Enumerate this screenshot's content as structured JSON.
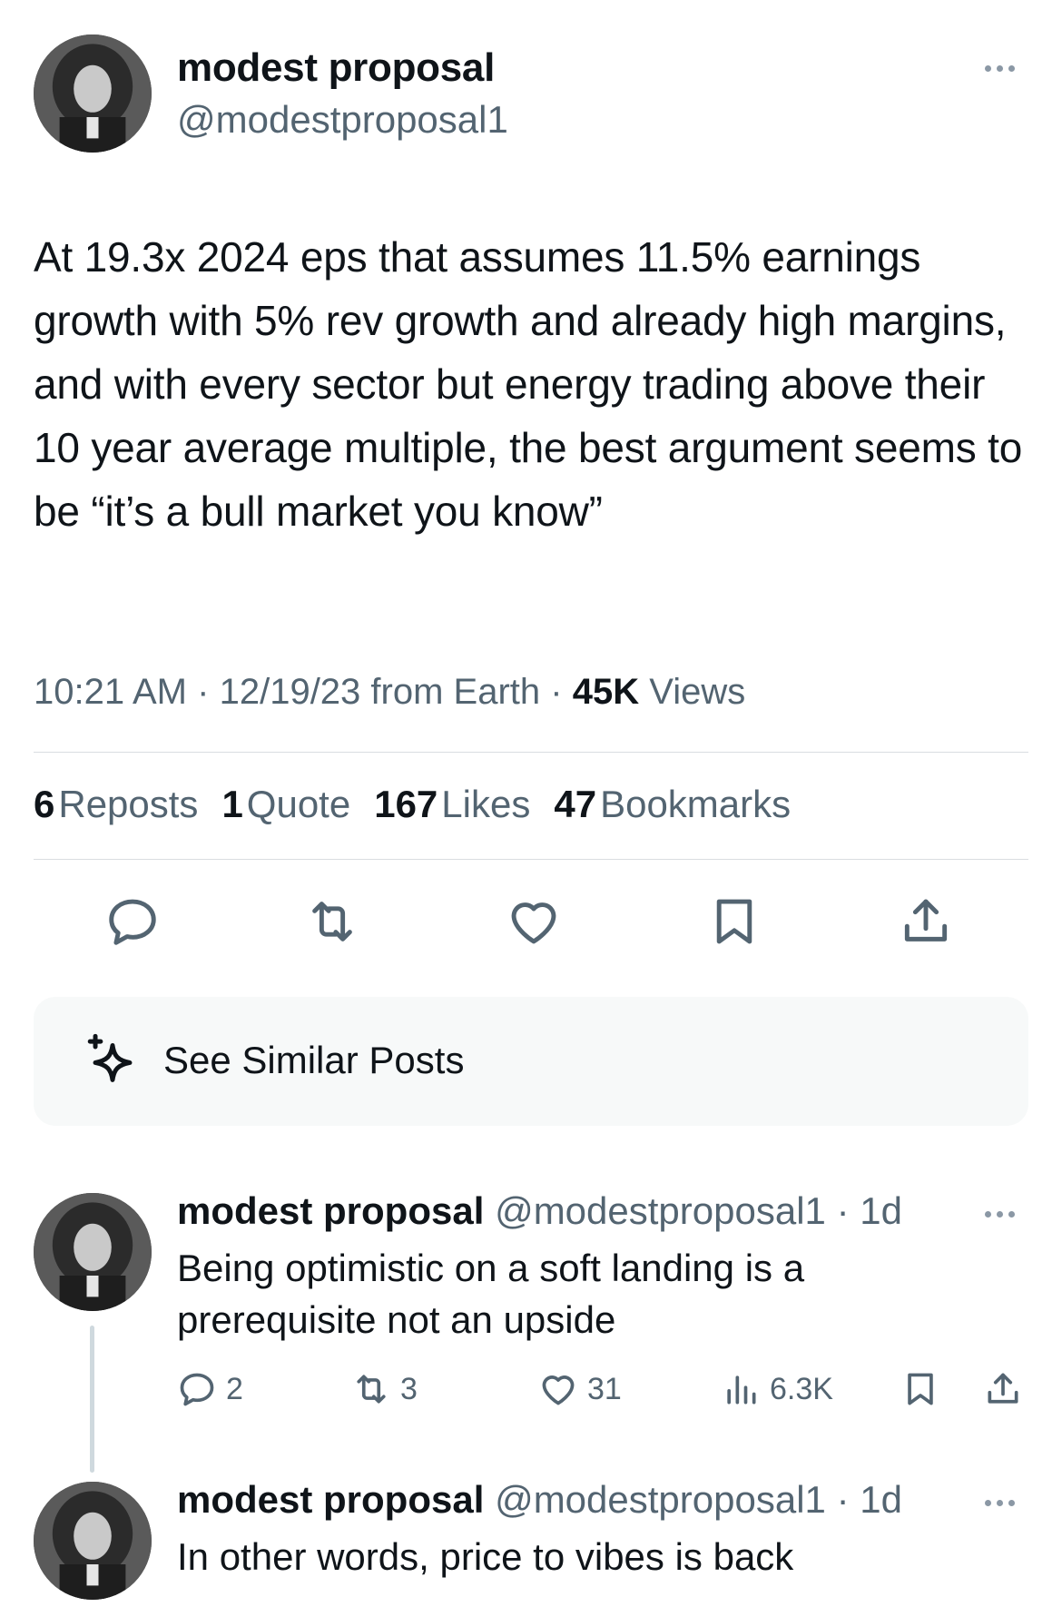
{
  "colors": {
    "text": "#0f1419",
    "muted": "#536471",
    "divider": "#d9dde1",
    "card_bg": "#f7f9f9"
  },
  "main_tweet": {
    "name": "modest proposal",
    "handle": "@modestproposal1",
    "text": "At 19.3x 2024 eps that assumes 11.5% earnings growth with 5% rev growth and already high margins, and with every sector but energy trading above their 10 year average multiple, the best argument seems to be “it’s a bull market you know”",
    "time": "10:21 AM",
    "sep1": "·",
    "date_location": "12/19/23 from Earth",
    "sep2": "·",
    "views_count": "45K",
    "views_label": "Views",
    "stats": {
      "reposts_n": "6",
      "reposts_l": "Reposts",
      "quote_n": "1",
      "quote_l": "Quote",
      "likes_n": "167",
      "likes_l": "Likes",
      "bookmarks_n": "47",
      "bookmarks_l": "Bookmarks"
    },
    "actions": [
      "reply-icon",
      "repost-icon",
      "like-icon",
      "bookmark-icon",
      "share-icon"
    ]
  },
  "similar": {
    "label": "See Similar Posts",
    "icon": "sparkle-icon"
  },
  "replies": [
    {
      "name": "modest proposal",
      "handle": "@modestproposal1",
      "age": "· 1d",
      "text": "Being optimistic on a soft landing is a prerequisite not an upside",
      "reply_count": "2",
      "repost_count": "3",
      "like_count": "31",
      "view_count": "6.3K"
    },
    {
      "name": "modest proposal",
      "handle": "@modestproposal1",
      "age": "· 1d",
      "text": "In other words, price to vibes is back"
    }
  ]
}
